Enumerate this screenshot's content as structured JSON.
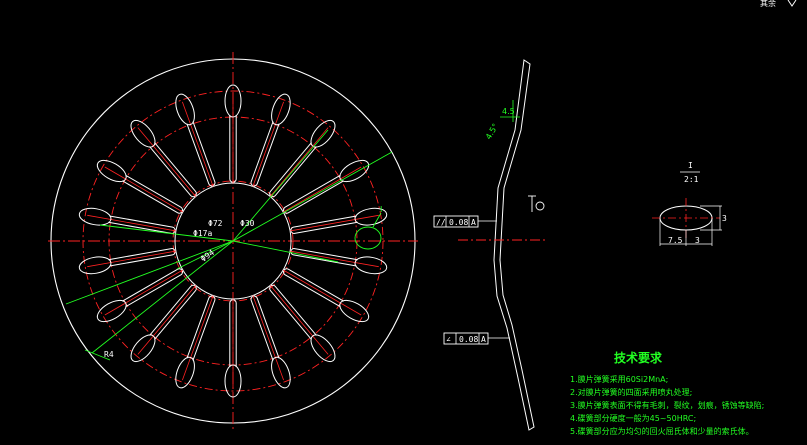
{
  "corner_label": "其余",
  "front_view": {
    "dims": [
      "Φ72",
      "Φ30",
      "Φ17a",
      "Φ94",
      "R4"
    ],
    "detail_callout": "I"
  },
  "side_view": {
    "angle_dim": "4.5",
    "angle_top": "4.5°",
    "tolerance_1": {
      "symbol": "//",
      "value": "0.08",
      "datum": "A"
    },
    "tolerance_2": {
      "symbol": "∠",
      "value": "0.08",
      "datum": "A"
    }
  },
  "detail_view": {
    "title": "I",
    "scale": "2:1",
    "dim_width_a": "7.5",
    "dim_width_b": "3",
    "dim_height": "3"
  },
  "tech_req": {
    "title": "技术要求",
    "items": [
      "1.膜片弹簧采用60Si2MnA;",
      "2.对膜片弹簧的四面采用喷丸处理;",
      "3.膜片弹簧表面不得有毛刺，裂纹，划痕，锈蚀等缺陷;",
      "4.碟簧部分硬度一般为45~50HRC;",
      "5.碟簧部分应为均匀的回火屈氏体和少量的索氏体。"
    ]
  },
  "colors": {
    "outline": "#ffffff",
    "centerline": "#ff2222",
    "dimension": "#22ff22",
    "background": "#000000"
  }
}
